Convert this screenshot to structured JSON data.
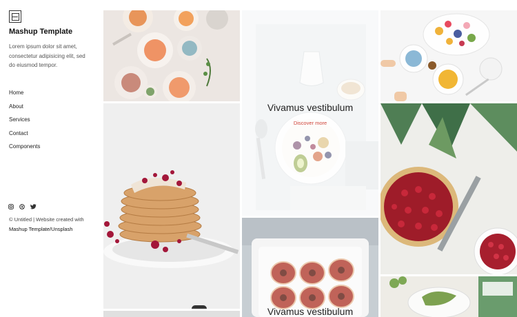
{
  "brand": {
    "logo_icon": "square-logo-icon",
    "name": "Mashup Template",
    "tagline": "Lorem ipsum dolor sit amet, consectetur adipisicing elit, sed do eiusmod tempor."
  },
  "nav": {
    "items": [
      {
        "label": "Home"
      },
      {
        "label": "About"
      },
      {
        "label": "Services"
      },
      {
        "label": "Contact"
      },
      {
        "label": "Components"
      }
    ]
  },
  "social": {
    "icons": [
      "instagram-icon",
      "dribbble-icon",
      "twitter-icon"
    ]
  },
  "footer": {
    "copyright": "© Untitled | Website created with",
    "credit": "Mashup Template/Unsplash"
  },
  "gallery": {
    "featured": {
      "title": "Vivamus vestibulum",
      "link": "Discover more"
    },
    "second": {
      "title": "Vivamus vestibulum"
    }
  },
  "colors": {
    "accent": "#d0453b",
    "text": "#222222"
  }
}
